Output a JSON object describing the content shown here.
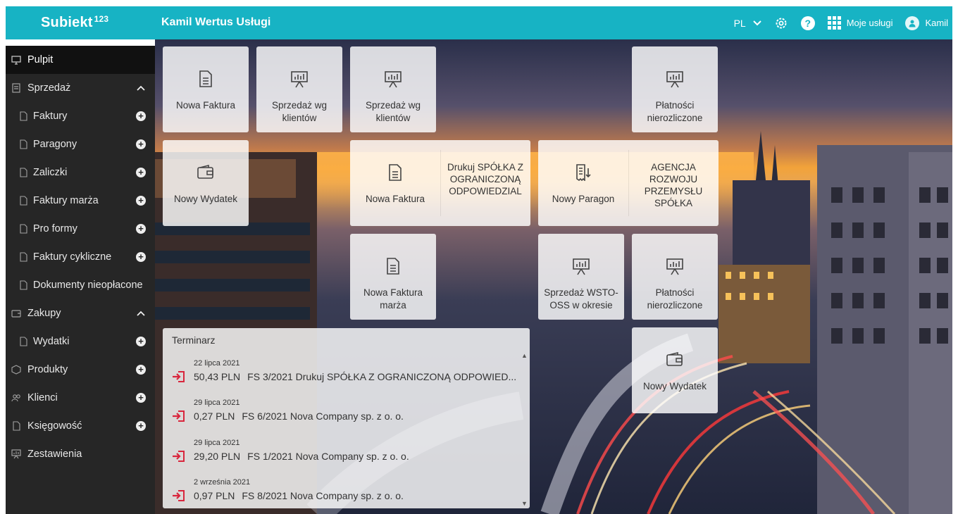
{
  "header": {
    "logo": "Subiekt",
    "logo_sup": "123",
    "company": "Kamil Wertus Usługi",
    "lang": "PL",
    "services": "Moje usługi",
    "user": "Kamil"
  },
  "sidebar": {
    "items": [
      {
        "label": "Pulpit"
      },
      {
        "label": "Sprzedaż"
      },
      {
        "label": "Faktury"
      },
      {
        "label": "Paragony"
      },
      {
        "label": "Zaliczki"
      },
      {
        "label": "Faktury marża"
      },
      {
        "label": "Pro formy"
      },
      {
        "label": "Faktury cykliczne"
      },
      {
        "label": "Dokumenty nieopłacone"
      },
      {
        "label": "Zakupy"
      },
      {
        "label": "Wydatki"
      },
      {
        "label": "Produkty"
      },
      {
        "label": "Klienci"
      },
      {
        "label": "Księgowość"
      },
      {
        "label": "Zestawienia"
      }
    ]
  },
  "tiles": {
    "t1": "Nowa Faktura",
    "t2": "Sprzedaż wg klientów",
    "t3": "Sprzedaż wg klientów",
    "t4": "Płatności nierozliczone",
    "t5": "Nowy Wydatek",
    "t6a": "Nowa Faktura",
    "t6b": "Drukuj SPÓŁKA Z OGRANICZONĄ ODPOWIEDZIAL",
    "t7a": "Nowy Paragon",
    "t7b": "AGENCJA ROZWOJU PRZEMYSŁU SPÓŁKA",
    "t8": "Nowa Faktura marża",
    "t9": "Sprzedaż WSTO-OSS w okresie",
    "t10": "Płatności nierozliczone",
    "t11": "Nowy Wydatek"
  },
  "terminarz": {
    "title": "Terminarz",
    "rows": [
      {
        "date": "22 lipca 2021",
        "amount": "50,43 PLN",
        "doc": "FS 3/2021 Drukuj SPÓŁKA Z OGRANICZONĄ ODPOWIED..."
      },
      {
        "date": "29 lipca 2021",
        "amount": "0,27 PLN",
        "doc": "FS 6/2021 Nova Company sp. z o. o."
      },
      {
        "date": "29 lipca 2021",
        "amount": "29,20 PLN",
        "doc": "FS 1/2021 Nova Company sp. z o. o."
      },
      {
        "date": "2 września 2021",
        "amount": "0,97 PLN",
        "doc": "FS 8/2021 Nova Company sp. z o. o."
      }
    ]
  },
  "colors": {
    "topbar": "#17b3c4",
    "sidebar": "#262626",
    "accent_red": "#d9263d"
  }
}
